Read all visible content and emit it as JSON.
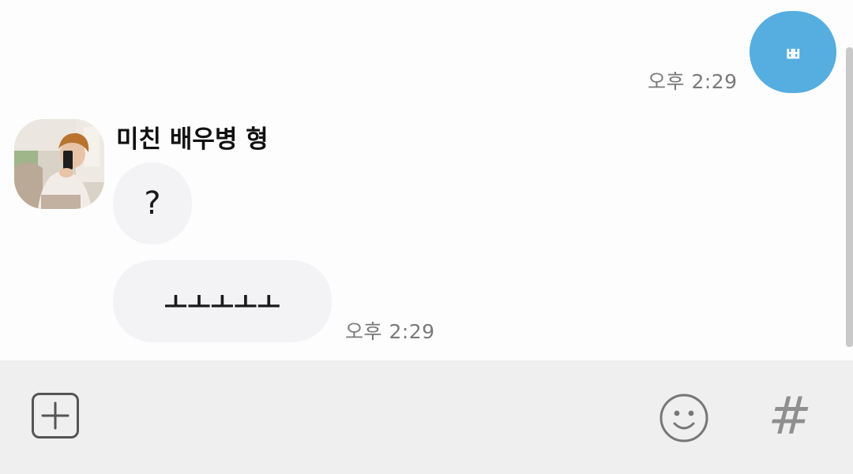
{
  "conversation": {
    "my_message": {
      "text": "ㅃ",
      "time": "오후 2:29",
      "bubble_color": "#55ade0"
    },
    "other": {
      "sender_name": "미친 배우병 형",
      "avatar": "profile-photo",
      "messages": [
        {
          "text": "?"
        },
        {
          "text": "ㅗㅗㅗㅗㅗ"
        }
      ],
      "time": "오후 2:29",
      "bubble_color": "#f3f3f6"
    }
  },
  "input_bar": {
    "plus_icon": "add-attachment-icon",
    "emoji_icon": "emoticon-icon",
    "hash_label": "#"
  }
}
